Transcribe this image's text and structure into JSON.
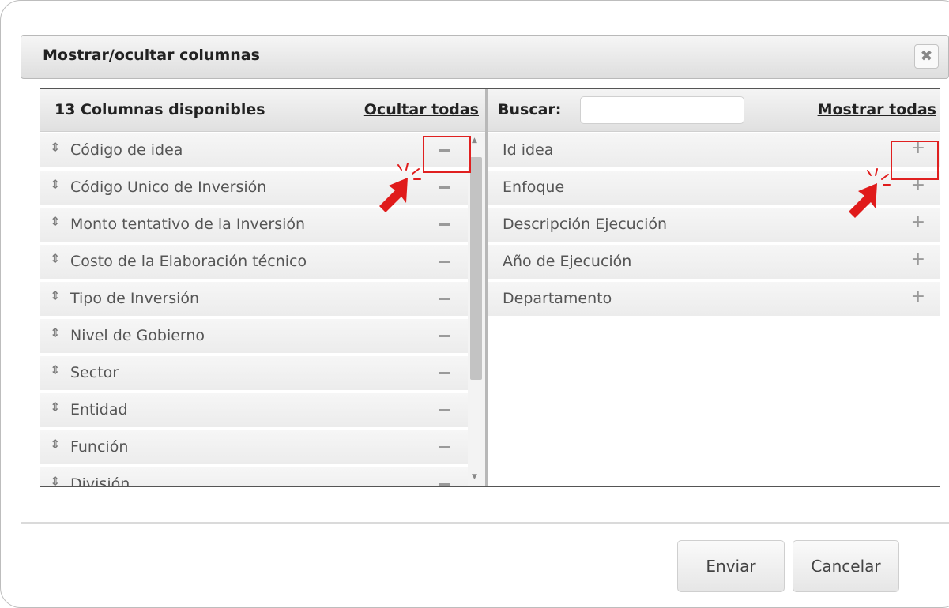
{
  "dialog": {
    "title": "Mostrar/ocultar columnas",
    "close_glyph": "✖"
  },
  "left_panel": {
    "header": "13 Columnas disponibles",
    "hide_all_label": "Ocultar todas",
    "items": [
      {
        "label": "Código de idea"
      },
      {
        "label": "Código Unico de Inversión"
      },
      {
        "label": "Monto tentativo de la Inversión"
      },
      {
        "label": "Costo de la Elaboración técnico"
      },
      {
        "label": "Tipo de Inversión"
      },
      {
        "label": "Nivel de Gobierno"
      },
      {
        "label": "Sector"
      },
      {
        "label": "Entidad"
      },
      {
        "label": "Función"
      },
      {
        "label": "División"
      }
    ]
  },
  "right_panel": {
    "search_label": "Buscar:",
    "search_value": "",
    "show_all_label": "Mostrar todas",
    "items": [
      {
        "label": "Id idea"
      },
      {
        "label": "Enfoque"
      },
      {
        "label": "Descripción Ejecución"
      },
      {
        "label": "Año de Ejecución"
      },
      {
        "label": "Departamento"
      }
    ]
  },
  "footer": {
    "submit_label": "Enviar",
    "cancel_label": "Cancelar"
  },
  "glyphs": {
    "grip": "⇕",
    "plus": "+",
    "scroll_up": "▲",
    "scroll_down": "▼"
  },
  "colors": {
    "highlight": "#e02020",
    "cursor": "#e01b1b"
  },
  "icons": [
    "drag-handle-icon",
    "remove-column-icon",
    "add-column-icon",
    "close-icon",
    "red-cursor-icon"
  ]
}
